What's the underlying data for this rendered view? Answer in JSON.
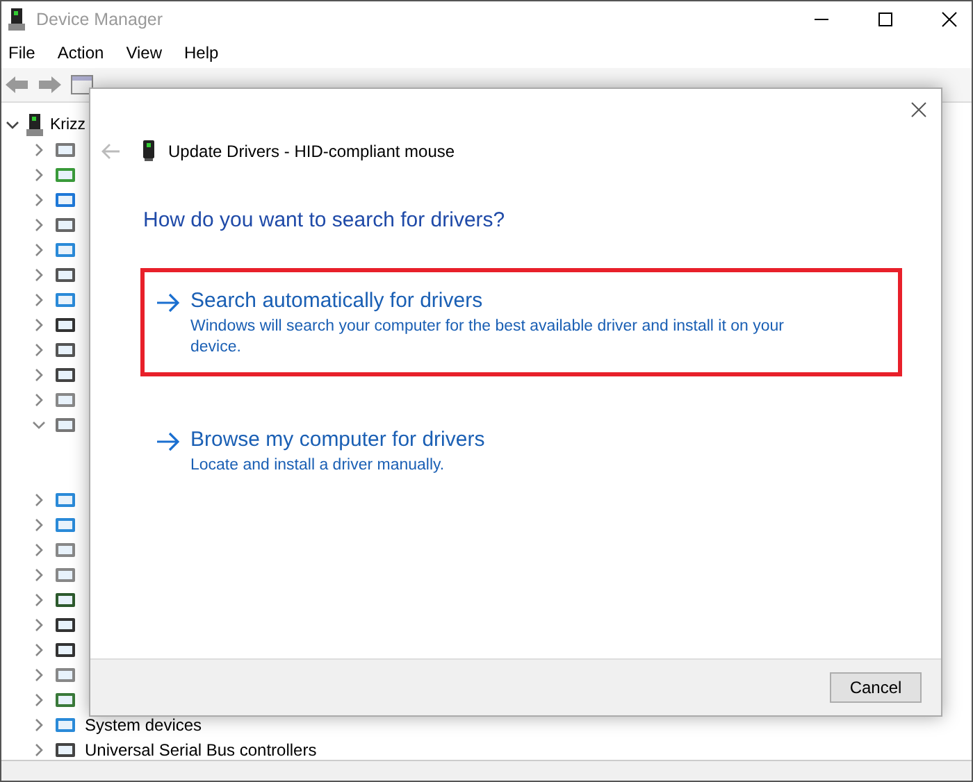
{
  "window": {
    "title": "Device Manager"
  },
  "menu": [
    "File",
    "Action",
    "View",
    "Help"
  ],
  "tree": {
    "label": "Krizz",
    "expanded": true,
    "children": [
      {
        "expanded": false
      },
      {
        "expanded": false
      },
      {
        "expanded": false
      },
      {
        "expanded": false
      },
      {
        "expanded": false
      },
      {
        "expanded": false
      },
      {
        "expanded": false
      },
      {
        "expanded": false
      },
      {
        "expanded": false
      },
      {
        "expanded": false
      },
      {
        "expanded": false
      },
      {
        "expanded": true
      },
      {
        "expanded": false
      },
      {
        "expanded": false
      },
      {
        "expanded": false
      },
      {
        "expanded": false
      },
      {
        "expanded": false
      },
      {
        "expanded": false
      },
      {
        "expanded": false
      },
      {
        "expanded": false
      },
      {
        "expanded": false
      },
      {
        "label": "System devices",
        "expanded": false
      },
      {
        "label": "Universal Serial Bus controllers",
        "expanded": false
      }
    ]
  },
  "dialog": {
    "title": "Update Drivers - HID-compliant mouse",
    "heading": "How do you want to search for drivers?",
    "options": [
      {
        "title": "Search automatically for drivers",
        "description": "Windows will search your computer for the best available driver and install it on your device.",
        "selected": true
      },
      {
        "title": "Browse my computer for drivers",
        "description": "Locate and install a driver manually.",
        "selected": false
      }
    ],
    "buttons": [
      "Cancel"
    ]
  }
}
